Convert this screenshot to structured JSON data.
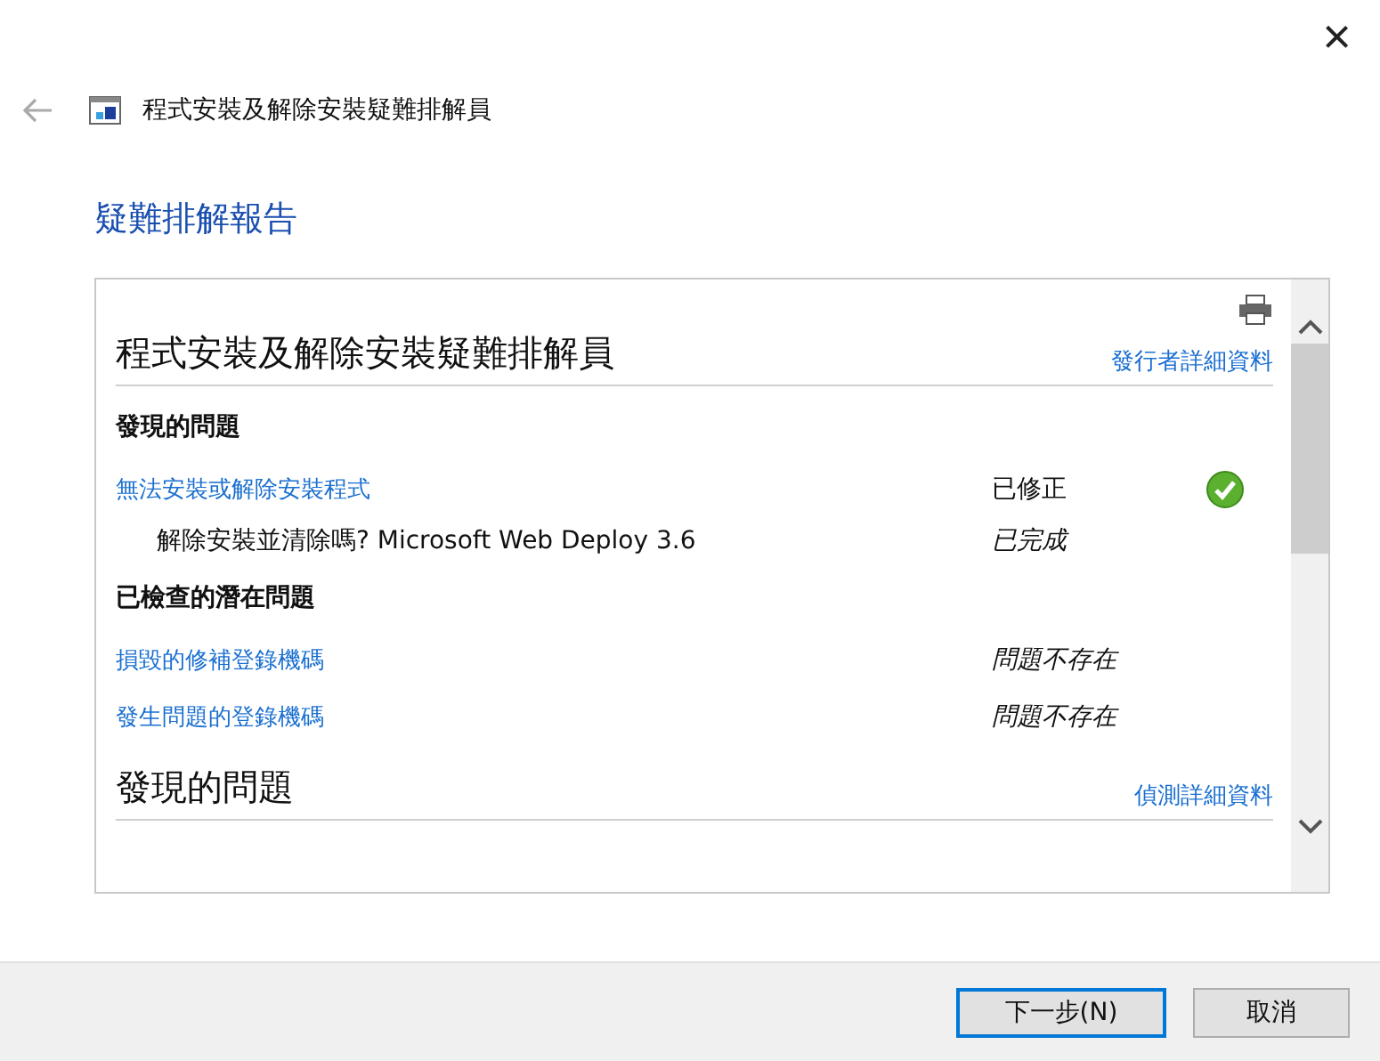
{
  "window": {
    "close": "×"
  },
  "nav": {
    "title": "程式安裝及解除安裝疑難排解員"
  },
  "heading": "疑難排解報告",
  "report": {
    "blocks": [
      {
        "kind": "title",
        "text": "程式安裝及解除安裝疑難排解員",
        "link": "發行者詳細資料"
      },
      {
        "kind": "group",
        "label": "發現的問題",
        "rows": [
          {
            "kind": "problem",
            "label": "無法安裝或解除安裝程式",
            "status": "已修正"
          },
          {
            "kind": "detail",
            "label": "解除安裝並清除嗎? Microsoft Web Deploy 3.6",
            "status": "已完成"
          }
        ]
      },
      {
        "kind": "group",
        "label": "已檢查的潛在問題",
        "rows": [
          {
            "kind": "check",
            "label": "損毀的修補登錄機碼",
            "status": "問題不存在"
          },
          {
            "kind": "check",
            "label": "發生問題的登錄機碼",
            "status": "問題不存在"
          }
        ]
      },
      {
        "kind": "title",
        "text": "發現的問題",
        "link": "偵測詳細資料"
      }
    ]
  },
  "buttons": [
    {
      "label": "下一步(N)",
      "selected": true
    },
    {
      "label": "取消",
      "selected": false
    }
  ]
}
